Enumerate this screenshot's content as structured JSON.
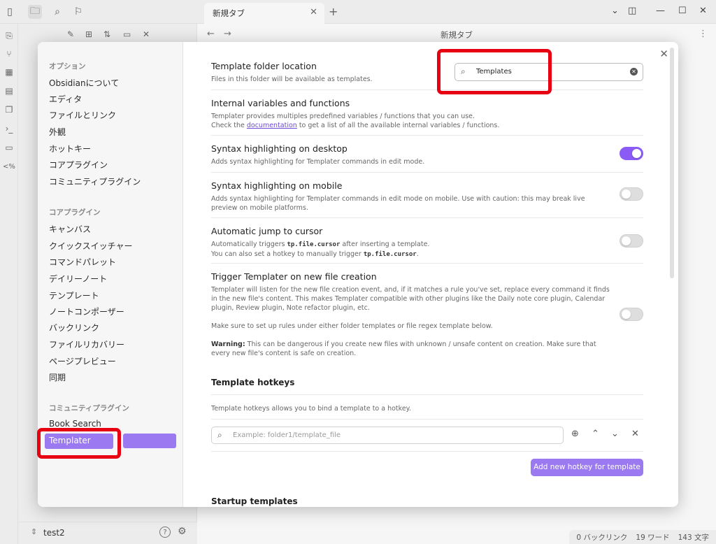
{
  "tabbar": {
    "tab_title": "新規タブ"
  },
  "editor": {
    "title": "新規タブ"
  },
  "vault": {
    "name": "test2"
  },
  "status": {
    "backlinks": "0 バックリンク",
    "words": "19 ワード",
    "chars": "143 文字"
  },
  "sidebar": {
    "options_header": "オプション",
    "options": [
      "Obsidianについて",
      "エディタ",
      "ファイルとリンク",
      "外観",
      "ホットキー",
      "コアプラグイン",
      "コミュニティプラグイン"
    ],
    "core_header": "コアプラグイン",
    "core": [
      "キャンバス",
      "クイックスイッチャー",
      "コマンドパレット",
      "デイリーノート",
      "テンプレート",
      "ノートコンポーザー",
      "バックリンク",
      "ファイルリカバリー",
      "ページプレビュー",
      "同期"
    ],
    "community_header": "コミュニティプラグイン",
    "community": [
      "Book Search",
      "Templater"
    ]
  },
  "settings": {
    "folder": {
      "name": "Template folder location",
      "desc": "Files in this folder will be available as templates.",
      "value": "Templates"
    },
    "internal": {
      "name": "Internal variables and functions",
      "desc1": "Templater provides multiples predefined variables / functions that you can use.",
      "desc2_pre": "Check the ",
      "desc2_link": "documentation",
      "desc2_post": " to get a list of all the available internal variables / functions."
    },
    "syntax_desktop": {
      "name": "Syntax highlighting on desktop",
      "desc": "Adds syntax highlighting for Templater commands in edit mode.",
      "enabled": true
    },
    "syntax_mobile": {
      "name": "Syntax highlighting on mobile",
      "desc": "Adds syntax highlighting for Templater commands in edit mode on mobile. Use with caution: this may break live preview on mobile platforms.",
      "enabled": false
    },
    "jump": {
      "name": "Automatic jump to cursor",
      "desc1_pre": "Automatically triggers ",
      "code": "tp.file.cursor",
      "desc1_post": " after inserting a template.",
      "desc2_pre": "You can also set a hotkey to manually trigger ",
      "desc2_post": ".",
      "enabled": false
    },
    "trigger": {
      "name": "Trigger Templater on new file creation",
      "desc1": "Templater will listen for the new file creation event, and, if it matches a rule you've set, replace every command it finds in the new file's content. This makes Templater compatible with other plugins like the Daily note core plugin, Calendar plugin, Review plugin, Note refactor plugin, etc.",
      "desc2": "Make sure to set up rules under either folder templates or file regex template below.",
      "warning_label": "Warning:",
      "warning_text": " This can be dangerous if you create new files with unknown / unsafe content on creation. Make sure that every new file's content is safe on creation.",
      "enabled": false
    }
  },
  "hotkeys": {
    "title": "Template hotkeys",
    "desc": "Template hotkeys allows you to bind a template to a hotkey.",
    "placeholder": "Example: folder1/template_file",
    "add_label": "Add new hotkey for template"
  },
  "startup": {
    "title": "Startup templates"
  },
  "colors": {
    "accent": "#9b79f0",
    "highlight": "#e60012"
  }
}
